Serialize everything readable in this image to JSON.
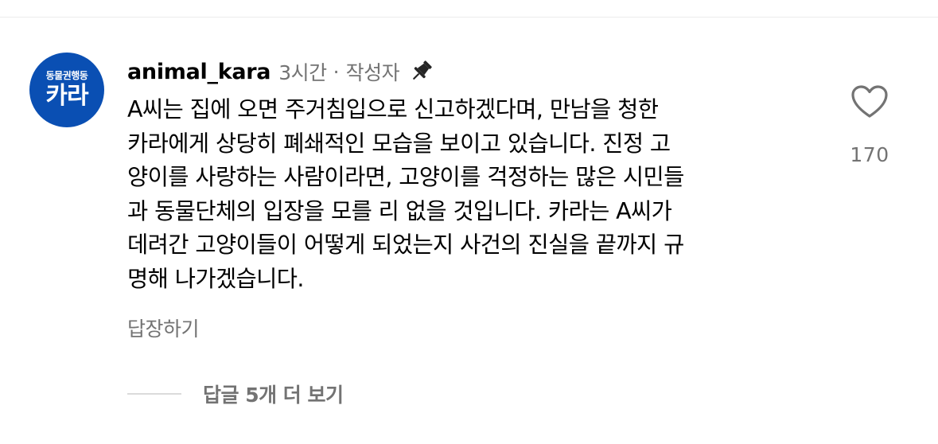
{
  "avatar": {
    "org_sub": "동물권행동",
    "org_main": "카라",
    "color": "#0a4fb3"
  },
  "comment": {
    "username": "animal_kara",
    "time": "3시간",
    "separator": "·",
    "author_badge": "작성자",
    "pin_icon": "pin-icon",
    "text": "A씨는 집에 오면 주거침입으로 신고하겠다며, 만남을 청한\n카라에게 상당히 폐쇄적인 모습을 보이고 있습니다. 진정 고\n양이를 사랑하는 사람이라면, 고양이를 걱정하는 많은 시민들\n과 동물단체의 입장을 모를 리 없을 것입니다. 카라는 A씨가\n데려간 고양이들이 어떻게 되었는지 사건의 진실을 끝까지 규\n명해 나가겠습니다.",
    "reply_label": "답장하기",
    "view_replies_label": "답글 5개 더 보기"
  },
  "like": {
    "icon": "heart-icon",
    "count": "170"
  },
  "colors": {
    "muted_text": "#737373",
    "divider": "#ececec"
  }
}
